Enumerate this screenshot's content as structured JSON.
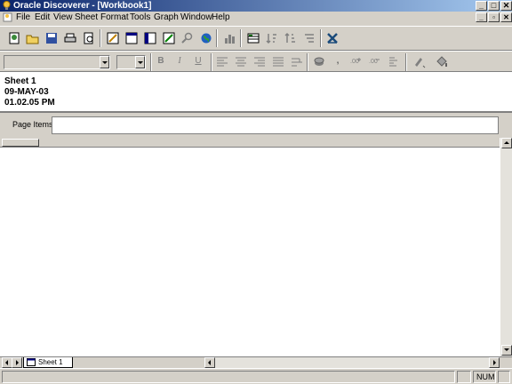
{
  "window": {
    "title": "Oracle Discoverer - [Workbook1]",
    "controls": [
      "_",
      "□",
      "✕"
    ],
    "mdi_controls": [
      "_",
      "▫",
      "✕"
    ]
  },
  "menu": [
    "File",
    "Edit",
    "View",
    "Sheet",
    "Format",
    "Tools",
    "Graph",
    "Window",
    "Help"
  ],
  "toolbar": {
    "buttons": [
      "new-workbook",
      "open",
      "save",
      "print",
      "print-preview",
      "edit-sheet",
      "layout",
      "table-layout",
      "crosstab-layout",
      "find",
      "web-export",
      "graph",
      "sort-ascending",
      "sort-descending",
      "sort-options",
      "drill"
    ]
  },
  "format_toolbar": {
    "font_value": "",
    "size_value": "",
    "bold": "B",
    "italic": "I",
    "underline": "U",
    "comma": ","
  },
  "sheet": {
    "name": "Sheet 1",
    "date": "09-MAY-03",
    "time": "01.02.05 PM"
  },
  "page_items": {
    "label": "Page Items:",
    "value": ""
  },
  "tabs": [
    {
      "label": "Sheet 1"
    }
  ],
  "status": {
    "num": "NUM"
  },
  "colors": {
    "titlebar_start": "#0a246a",
    "titlebar_end": "#a6caf0",
    "face": "#d4d0c8"
  }
}
